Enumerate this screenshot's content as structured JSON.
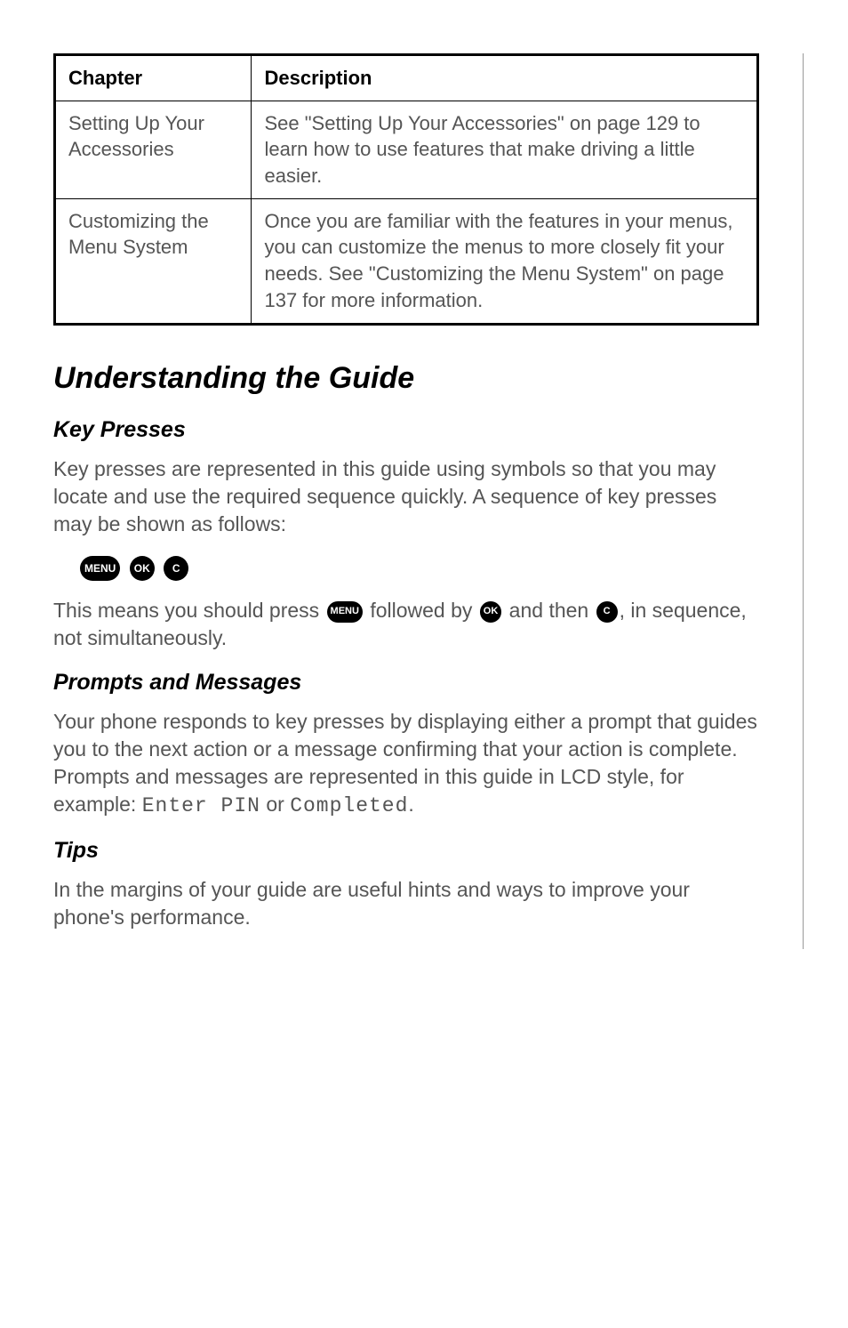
{
  "table": {
    "headers": {
      "chapter": "Chapter",
      "description": "Description"
    },
    "rows": [
      {
        "chapter": "Setting Up Your Accessories",
        "description": "See \"Setting Up Your Accessories\" on page 129 to learn how to use features that make driving a little easier."
      },
      {
        "chapter": "Customizing the Menu System",
        "description": "Once you are familiar with the features in your menus, you can customize the menus to more closely fit your needs. See \"Customizing the Menu System\" on page 137 for more information."
      }
    ]
  },
  "section_title": "Understanding the Guide",
  "key_presses": {
    "heading": "Key Presses",
    "para1": "Key presses are represented in this guide using symbols so that you may locate and use the required sequence quickly. A sequence of key presses may be shown as follows:",
    "icons": {
      "menu": "MENU",
      "ok": "OK",
      "c": "C"
    },
    "para2_parts": {
      "a": "This means you should press ",
      "b": " followed by ",
      "c": " and then ",
      "d": ", in sequence, not simultaneously."
    }
  },
  "prompts": {
    "heading": "Prompts and Messages",
    "para_parts": {
      "a": "Your phone responds to key presses by displaying either a prompt that guides you to the next action or a message confirming that your action is complete. Prompts and messages are represented in this guide in LCD style, for example: ",
      "lcd1": "Enter PIN",
      "mid": " or ",
      "lcd2": "Completed",
      "end": "."
    }
  },
  "tips": {
    "heading": "Tips",
    "para": "In the margins of your guide are useful hints and ways to improve your phone's performance."
  }
}
